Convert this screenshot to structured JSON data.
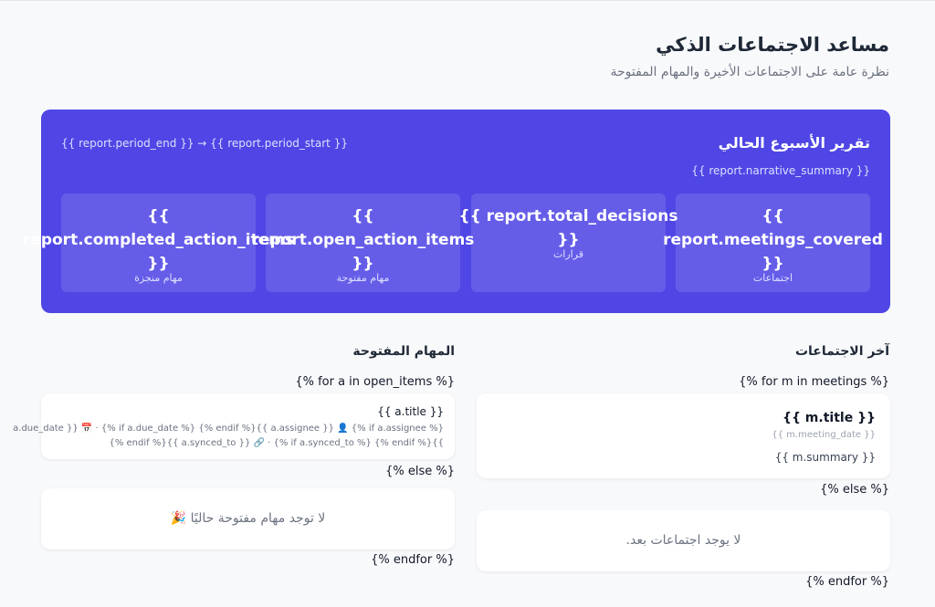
{
  "header": {
    "title": "مساعد الاجتماعات الذكي",
    "subtitle": "نظرة عامة على الاجتماعات الأخيرة والمهام المفتوحة"
  },
  "report": {
    "title": "تقرير الأسبوع الحالي",
    "period": "{{ report.period_end }} → {{ report.period_start }}",
    "narrative": "{{ report.narrative_summary }}",
    "stats": [
      {
        "value": "{{\nreport.meetings_covered\n}}",
        "label": "اجتماعات"
      },
      {
        "value": "{{ report.total_decisions\n}}",
        "label": "قرارات"
      },
      {
        "value": "{{\nreport.open_action_items\n}}",
        "label": "مهام مفتوحة"
      },
      {
        "value": "{{\nreport.completed_action_items\n}}",
        "label": "مهام منجزة"
      }
    ]
  },
  "meetings": {
    "title": "آخر الاجتماعات",
    "for_tag": "{% for m in meetings %}",
    "else_tag": "{% else %}",
    "endfor_tag": "{% endfor %}",
    "item_title": "{{ m.title }}",
    "item_date": "{{ m.meeting_date }}",
    "item_summary": "{{ m.summary }}",
    "empty": "لا يوجد اجتماعات بعد."
  },
  "tasks": {
    "title": "المهام المفتوحة",
    "for_tag": "{% for a in open_items %}",
    "else_tag": "{% else %}",
    "endfor_tag": "{% endfor %}",
    "item_title": "{{ a.title }}",
    "meta_line1": "a.due_date }} 📅 · {% if a.due_date %} {% endif %}{{ a.assignee }} 👤 {% if a.assignee %}",
    "meta_line2": "{% endif %}{{ a.synced_to }} 🔗 · {% if a.synced_to %} {% endif %}{{",
    "empty": "لا توجد مهام مفتوحة حاليًا 🎉"
  }
}
